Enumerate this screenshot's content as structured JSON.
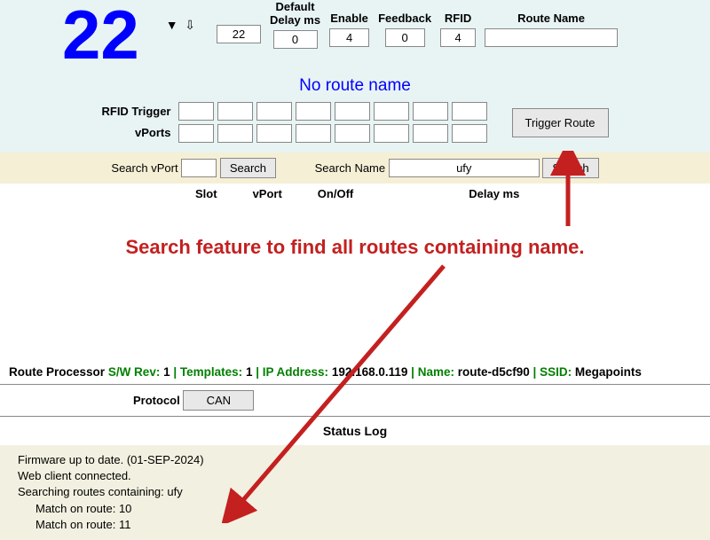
{
  "route_number": "22",
  "header_labels": {
    "default_delay": "Default\nDelay ms",
    "enable": "Enable",
    "feedback": "Feedback",
    "rfid": "RFID",
    "route_name": "Route Name"
  },
  "header_values": {
    "route_num_input": "22",
    "default_delay": "0",
    "enable": "4",
    "feedback": "0",
    "rfid": "4",
    "route_name": ""
  },
  "no_route_name": "No route name",
  "trigger": {
    "rfid_label": "RFID Trigger",
    "vports_label": "vPorts",
    "button": "Trigger Route"
  },
  "search": {
    "vport_label": "Search vPort",
    "vport_value": "",
    "name_label": "Search Name",
    "name_value": "ufy",
    "button": "Search"
  },
  "col_headers": {
    "slot": "Slot",
    "vport": "vPort",
    "onoff": "On/Off",
    "delay": "Delay ms"
  },
  "annotation": "Search feature to find all routes containing name.",
  "info": {
    "processor": "Route Processor",
    "sw_rev_lbl": "S/W Rev:",
    "sw_rev": "1",
    "templates_lbl": "Templates:",
    "templates": "1",
    "ip_lbl": "IP Address:",
    "ip": "192.168.0.119",
    "name_lbl": "Name:",
    "name": "route-d5cf90",
    "ssid_lbl": "SSID:",
    "ssid": "Megapoints"
  },
  "protocol": {
    "label": "Protocol",
    "value": "CAN"
  },
  "status_header": "Status Log",
  "status_lines": [
    "Firmware up to date. (01-SEP-2024)",
    "Web client connected.",
    "Searching routes containing: ufy"
  ],
  "status_matches": [
    "Match on route: 10",
    "Match on route: 11"
  ]
}
